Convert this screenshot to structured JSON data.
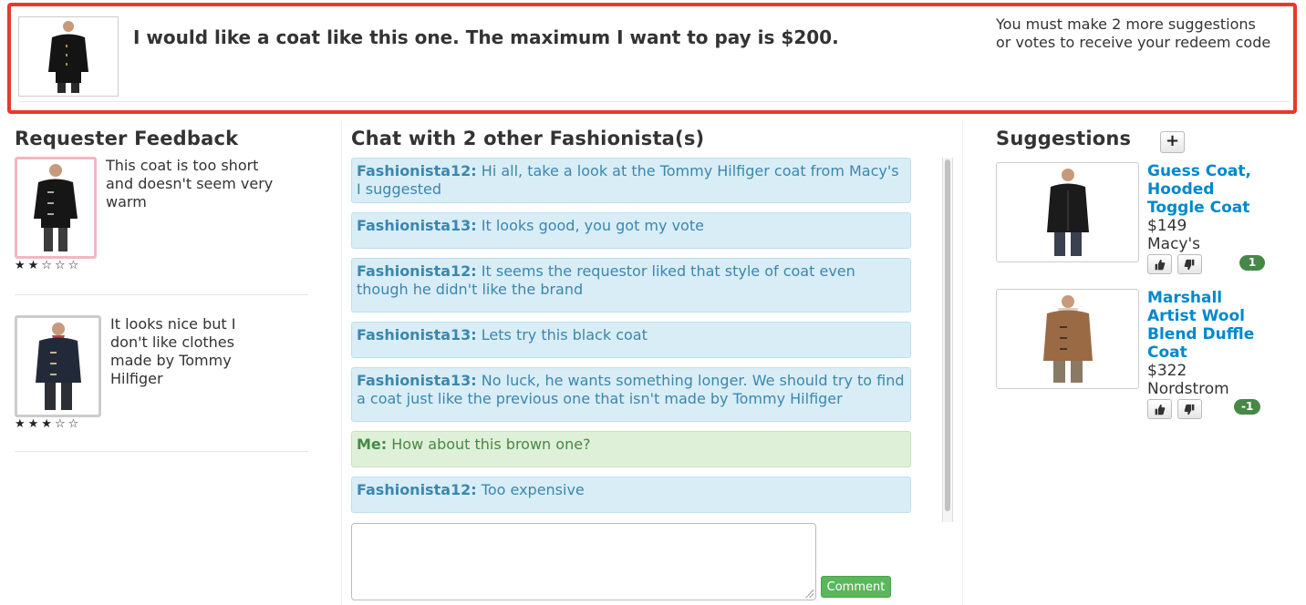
{
  "request": {
    "image_icon": "black-coat-photo",
    "text": "I would like a coat like this one. The maximum I want to pay is $200.",
    "status_line1": "You must make 2 more suggestions",
    "status_line2": "or votes to receive your redeem code",
    "accent_color": "#e8392a"
  },
  "feedback": {
    "title": "Requester Feedback",
    "items": [
      {
        "image_icon": "black-duffle-coat-photo",
        "text": "This coat is too short and doesn't seem very warm",
        "stars": "★★☆☆☆",
        "rating": 2
      },
      {
        "image_icon": "navy-duffle-coat-photo",
        "text": "It looks nice but I don't like clothes made by Tommy Hilfiger",
        "stars": "★★★☆☆",
        "rating": 3
      }
    ]
  },
  "chat": {
    "title": "Chat with 2 other Fashionista(s)",
    "messages": [
      {
        "author": "Fashionista12:",
        "text": "Hi all, take a look at the Tommy Hilfiger coat from Macy's I suggested",
        "mine": false
      },
      {
        "author": "Fashionista13:",
        "text": "It looks good, you got my vote",
        "mine": false
      },
      {
        "author": "Fashionista12:",
        "text": "It seems the requestor liked that style of coat even though he didn't like the brand",
        "mine": false
      },
      {
        "author": "Fashionista13:",
        "text": "Lets try this black coat",
        "mine": false
      },
      {
        "author": "Fashionista13:",
        "text": "No luck, he wants something longer. We should try to find a coat just like the previous one that isn't made by Tommy Hilfiger",
        "mine": false
      },
      {
        "author": "Me:",
        "text": "How about this brown one?",
        "mine": true
      },
      {
        "author": "Fashionista12:",
        "text": "Too expensive",
        "mine": false
      }
    ],
    "input_value": "",
    "comment_label": "Comment"
  },
  "suggestions": {
    "title": "Suggestions",
    "add_label": "+",
    "items": [
      {
        "image_icon": "black-hooded-coat-photo",
        "name": "Guess Coat, Hooded Toggle Coat",
        "price": "$149",
        "store": "Macy's",
        "votes": "1"
      },
      {
        "image_icon": "brown-duffle-coat-photo",
        "name": "Marshall Artist Wool Blend Duffle Coat",
        "price": "$322",
        "store": "Nordstrom",
        "votes": "-1"
      }
    ]
  }
}
